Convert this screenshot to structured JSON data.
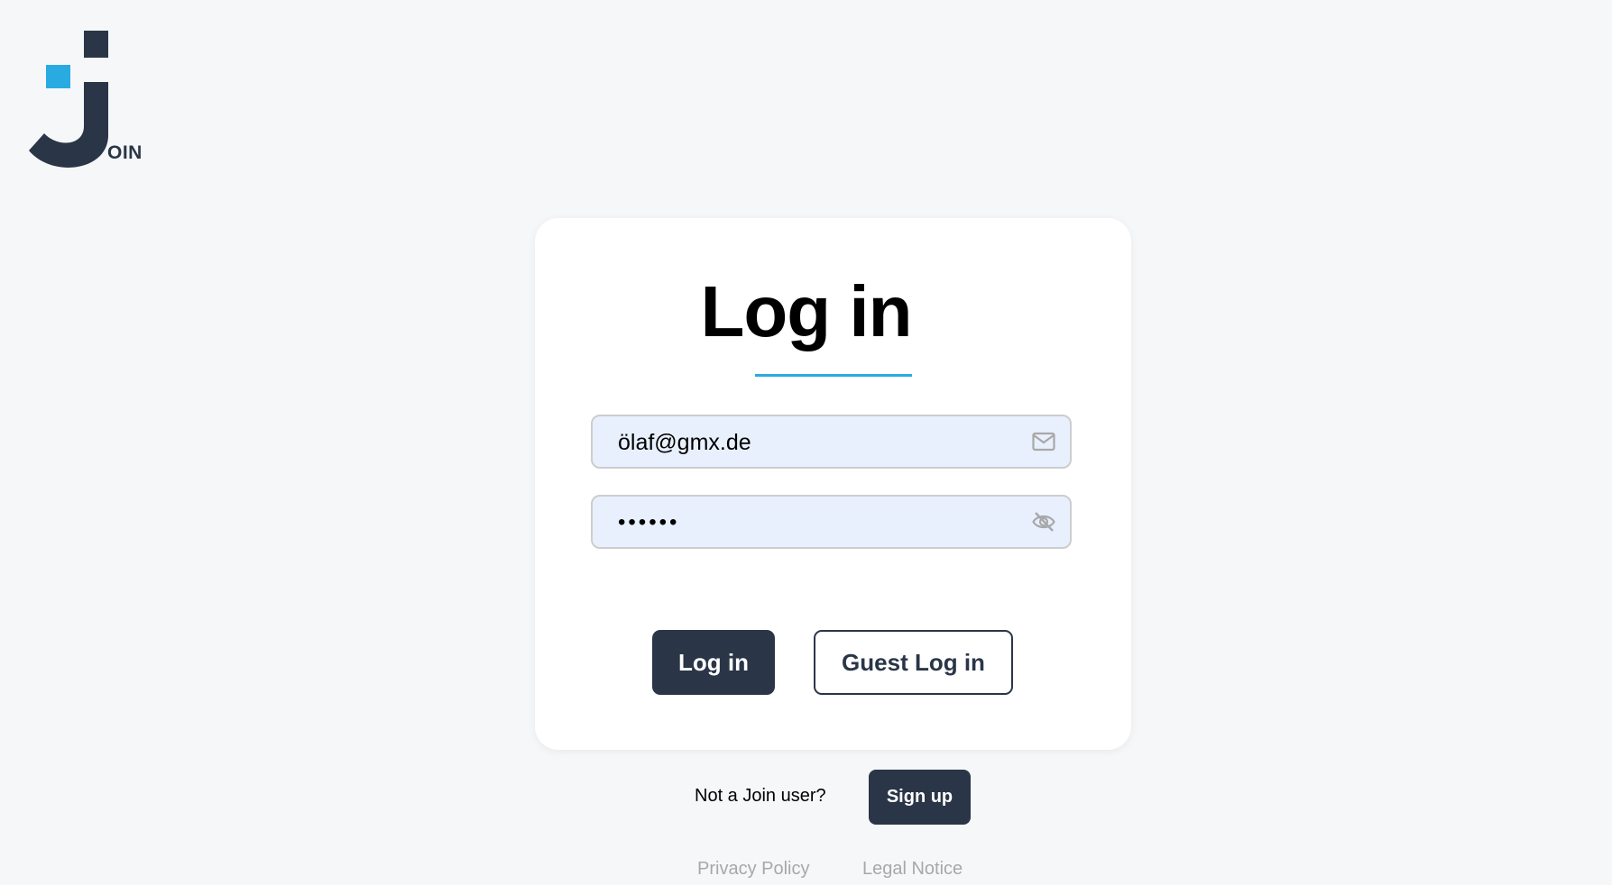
{
  "logo": {
    "text": "OIN",
    "colors": {
      "dark": "#2a3647",
      "accent": "#29abe2"
    }
  },
  "login": {
    "title": "Log in",
    "email": {
      "value": "ölaf@gmx.de",
      "icon": "mail-icon"
    },
    "password": {
      "value": "••••••",
      "icon": "eye-off-icon"
    },
    "login_button": "Log in",
    "guest_button": "Guest Log in"
  },
  "signup": {
    "prompt": "Not a Join user?",
    "button": "Sign up"
  },
  "footer": {
    "privacy": "Privacy Policy",
    "legal": "Legal Notice"
  }
}
